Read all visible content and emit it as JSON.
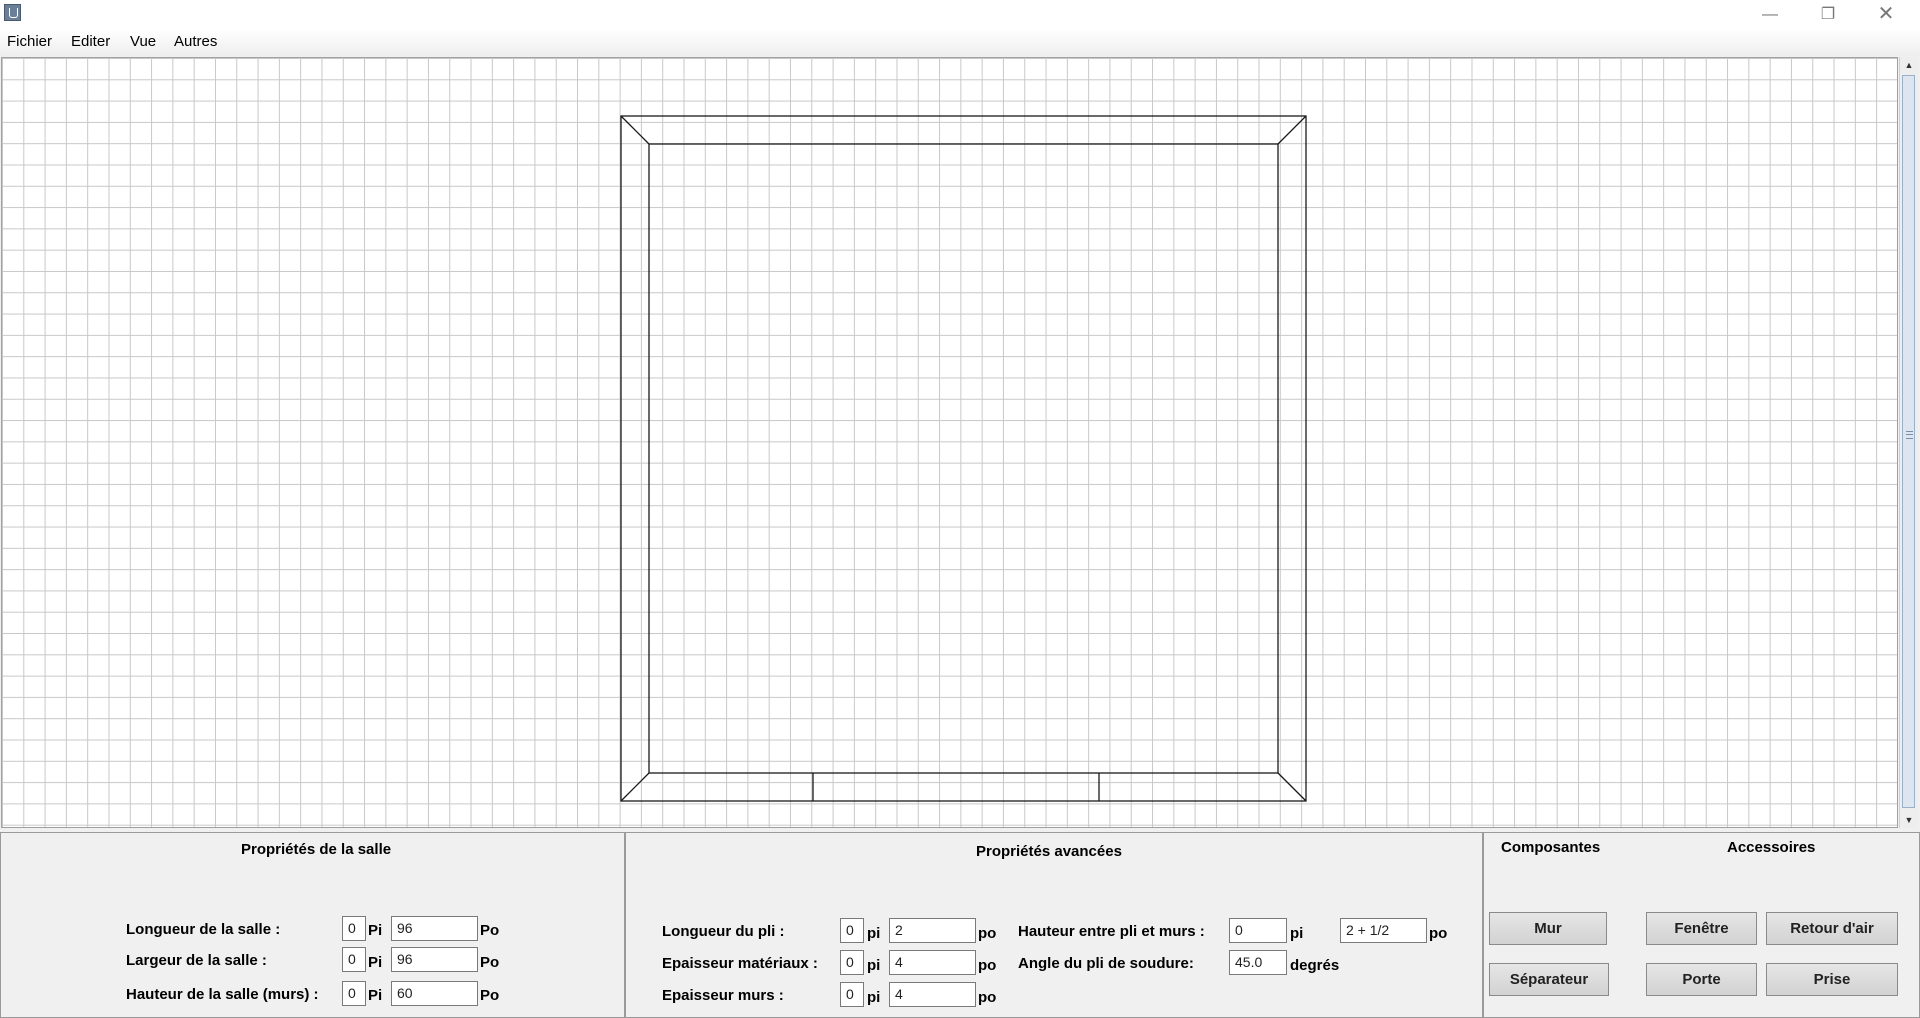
{
  "menu": [
    "Fichier",
    "Editer",
    "Vue",
    "Autres"
  ],
  "window_controls": {
    "minimize": "—",
    "maximize": "❐",
    "close": "✕"
  },
  "room_panel": {
    "title": "Propriétés de la salle",
    "rows": [
      {
        "label": "Longueur de la salle :",
        "feet": "0",
        "feet_unit": "Pi",
        "inches": "96",
        "inch_unit": "Po"
      },
      {
        "label": "Largeur de la salle :",
        "feet": "0",
        "feet_unit": "Pi",
        "inches": "96",
        "inch_unit": "Po"
      },
      {
        "label": "Hauteur de la salle (murs) :",
        "feet": "0",
        "feet_unit": "Pi",
        "inches": "60",
        "inch_unit": "Po"
      }
    ]
  },
  "advanced_panel": {
    "title": "Propriétés avancées",
    "left_rows": [
      {
        "label": "Longueur du pli :",
        "feet": "0",
        "feet_unit": "pi",
        "inches": "2",
        "inch_unit": "po"
      },
      {
        "label": "Epaisseur matériaux :",
        "feet": "0",
        "feet_unit": "pi",
        "inches": "4",
        "inch_unit": "po"
      },
      {
        "label": "Epaisseur murs :",
        "feet": "0",
        "feet_unit": "pi",
        "inches": "4",
        "inch_unit": "po"
      }
    ],
    "height_between": {
      "label": "Hauteur entre pli et murs :",
      "feet": "0",
      "feet_unit": "pi",
      "inches": "2 + 1/2",
      "inch_unit": "po"
    },
    "weld_angle": {
      "label": "Angle du pli de soudure:",
      "value": "45.0",
      "unit": "degrés"
    }
  },
  "components_panel": {
    "components_title": "Composantes",
    "accessories_title": "Accessoires",
    "buttons": {
      "wall": "Mur",
      "separator": "Séparateur",
      "window": "Fenêtre",
      "air_return": "Retour d'air",
      "door": "Porte",
      "outlet": "Prise"
    }
  }
}
